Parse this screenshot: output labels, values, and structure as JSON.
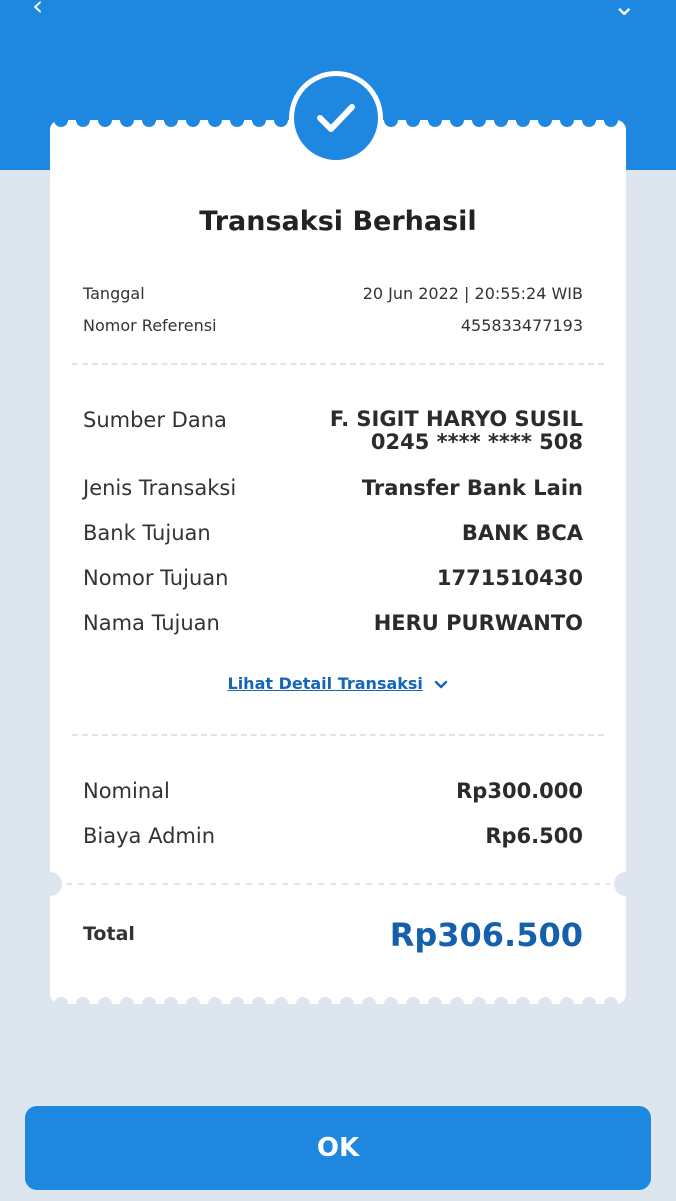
{
  "header": {
    "back_icon": "chevron-left-icon",
    "menu_icon": "chevron-down-icon",
    "color": "#1e88e0"
  },
  "receipt": {
    "status_icon": "check-icon",
    "title": "Transaksi Berhasil",
    "meta": [
      {
        "label": "Tanggal",
        "value": "20 Jun 2022 | 20:55:24 WIB"
      },
      {
        "label": "Nomor Referensi",
        "value": "455833477193"
      }
    ],
    "source": {
      "label": "Sumber Dana",
      "name": "F. SIGIT HARYO SUSIL",
      "account": "0245 **** **** 508"
    },
    "details": [
      {
        "label": "Jenis Transaksi",
        "value": "Transfer Bank Lain"
      },
      {
        "label": "Bank Tujuan",
        "value": "BANK BCA"
      },
      {
        "label": "Nomor Tujuan",
        "value": "1771510430"
      },
      {
        "label": "Nama Tujuan",
        "value": "HERU PURWANTO"
      }
    ],
    "detail_link": "Lihat Detail Transaksi",
    "amounts": [
      {
        "label": "Nominal",
        "value": "Rp300.000"
      },
      {
        "label": "Biaya Admin",
        "value": "Rp6.500"
      }
    ],
    "total": {
      "label": "Total",
      "value": "Rp306.500"
    }
  },
  "ok_button": {
    "label": "OK"
  },
  "colors": {
    "primary": "#1e88e0",
    "total_text": "#1560ad",
    "background": "#dde5ee"
  }
}
